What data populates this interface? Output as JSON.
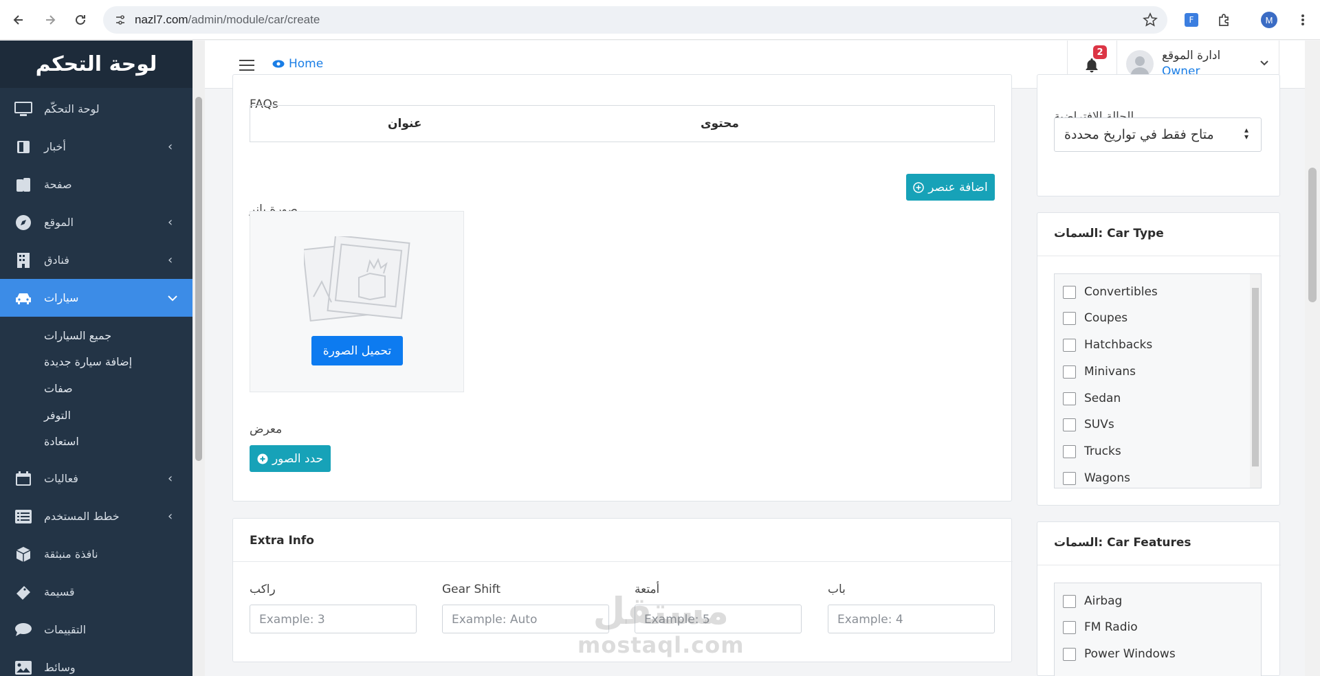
{
  "browser": {
    "url_host": "nazl7.com",
    "url_path": "/admin/module/car/create",
    "profile_initial": "M"
  },
  "sidebar": {
    "title": "لوحة التحكم",
    "items": [
      {
        "label": "لوحة التحكّم",
        "icon": "monitor-icon",
        "has_submenu": false
      },
      {
        "label": "أخبار",
        "icon": "book-icon",
        "has_submenu": true
      },
      {
        "label": "صفحة",
        "icon": "pages-icon",
        "has_submenu": false
      },
      {
        "label": "الموقع",
        "icon": "compass-icon",
        "has_submenu": true
      },
      {
        "label": "فنادق",
        "icon": "building-icon",
        "has_submenu": true
      },
      {
        "label": "سيارات",
        "icon": "car-icon",
        "has_submenu": true,
        "active": true
      },
      {
        "label": "فعاليات",
        "icon": "calendar-icon",
        "has_submenu": true
      },
      {
        "label": "خطط المستخدم",
        "icon": "list-icon",
        "has_submenu": true
      },
      {
        "label": "نافذة منبثقة",
        "icon": "box-icon",
        "has_submenu": false
      },
      {
        "label": "قسيمة",
        "icon": "ticket-icon",
        "has_submenu": false
      },
      {
        "label": "التقييمات",
        "icon": "comment-icon",
        "has_submenu": false
      },
      {
        "label": "وسائط",
        "icon": "image-icon",
        "has_submenu": false
      }
    ],
    "submenu": [
      "جميع السيارات",
      "إضافة سيارة جديدة",
      "صفات",
      "التوفر",
      "استعادة"
    ]
  },
  "topnav": {
    "home_label": "Home",
    "notification_count": "2",
    "user_name": "ادارة الموقع",
    "user_role": "Owner"
  },
  "main": {
    "faqs_label": "FAQs",
    "faq_columns": {
      "title": "عنوان",
      "content": "محتوى"
    },
    "add_item_button": "اضافة عنصر",
    "banner_label": "صورة بانر",
    "upload_button": "تحميل الصورة",
    "gallery_label": "معرض",
    "select_images_button": "حدد الصور",
    "extra_info_title": "Extra Info",
    "extra_fields": [
      {
        "label": "راكب",
        "placeholder": "Example: 3"
      },
      {
        "label": "Gear Shift",
        "placeholder": "Example: Auto"
      },
      {
        "label": "أمتعة",
        "placeholder": "Example: 5"
      },
      {
        "label": "باب",
        "placeholder": "Example: 4"
      }
    ]
  },
  "right": {
    "default_state_label": "الحالة الافتراضية",
    "default_state_value": "متاح فقط في تواريخ محددة",
    "car_type_title_ar": "السمات:",
    "car_type_title_en": "Car Type",
    "car_types": [
      "Convertibles",
      "Coupes",
      "Hatchbacks",
      "Minivans",
      "Sedan",
      "SUVs",
      "Trucks",
      "Wagons"
    ],
    "car_features_title_ar": "السمات:",
    "car_features_title_en": "Car Features",
    "car_features": [
      "Airbag",
      "FM Radio",
      "Power Windows"
    ]
  },
  "watermark": {
    "arabic": "مستقل",
    "latin": "mostaql.com"
  },
  "colors": {
    "sidebar_bg": "#233446",
    "active": "#3c8ce7",
    "teal": "#17a2b8",
    "primary": "#0d7bf0",
    "badge": "#dc3545"
  }
}
